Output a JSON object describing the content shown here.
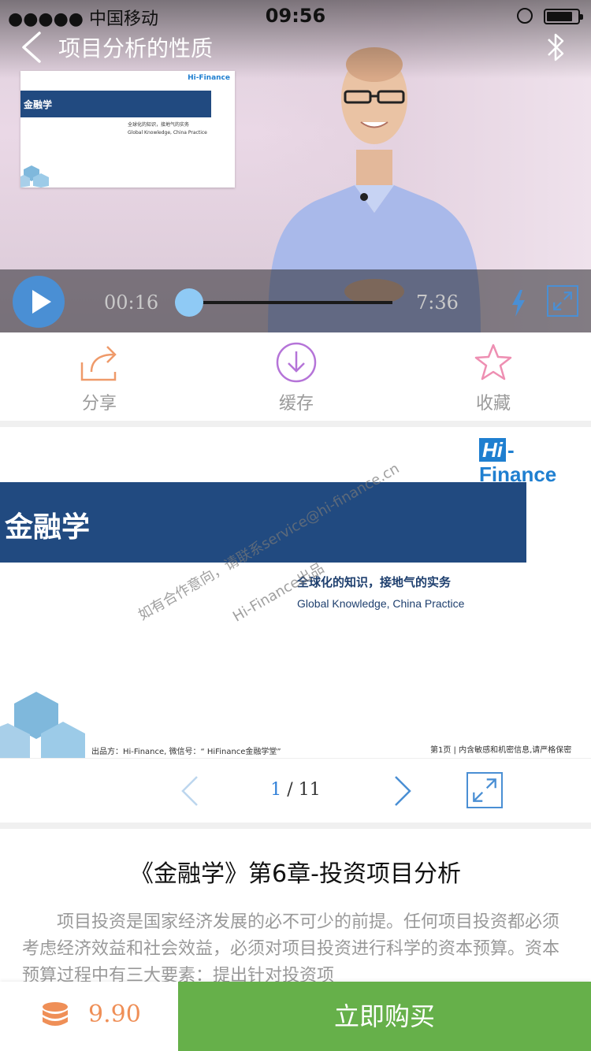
{
  "status_bar": {
    "carrier": "●●●●● 中国移动",
    "time": "09:56"
  },
  "header": {
    "title": "项目分析的性质"
  },
  "video_slide_thumb": {
    "brand": "Hi-Finance",
    "title": "金融学",
    "subtitle_cn": "全球化的知识，接地气的实务",
    "subtitle_en": "Global Knowledge, China Practice"
  },
  "player": {
    "current_time": "00:16",
    "duration": "7:36",
    "progress": 0.035
  },
  "actions": [
    {
      "label": "分享",
      "icon": "share-icon",
      "color": "#ef9a6a"
    },
    {
      "label": "缓存",
      "icon": "download-icon",
      "color": "#b574d8"
    },
    {
      "label": "收藏",
      "icon": "star-icon",
      "color": "#ee8fb2"
    }
  ],
  "slide": {
    "brand_hi": "Hi",
    "brand_rest": "-Finance",
    "title": "金融学",
    "subtitle_cn": "全球化的知识，接地气的实务",
    "subtitle_en": "Global Knowledge, China Practice",
    "watermark_1": "如有合作意向，请联系service@hi-finance.cn",
    "watermark_2": "Hi-Finance出品",
    "footer_left": "出品方：Hi-Finance, 微信号：“ HiFinance金融学堂”",
    "footer_right": "第1页 | 内含敏感和机密信息,请严格保密"
  },
  "pager": {
    "current": "1",
    "separator": " / ",
    "total": "11"
  },
  "course": {
    "title": "《金融学》第6章-投资项目分析",
    "description": "项目投资是国家经济发展的必不可少的前提。任何项目投资都必须考虑经济效益和社会效益，必须对项目投资进行科学的资本预算。资本预算过程中有三大要素：提出针对投资项"
  },
  "buy": {
    "price": "9.90",
    "button_label": "立即购买"
  },
  "colors": {
    "accent_blue": "#4a8fd4",
    "buy_green": "#66b04a",
    "price_orange": "#ef8f57",
    "slide_band": "#214a80"
  }
}
